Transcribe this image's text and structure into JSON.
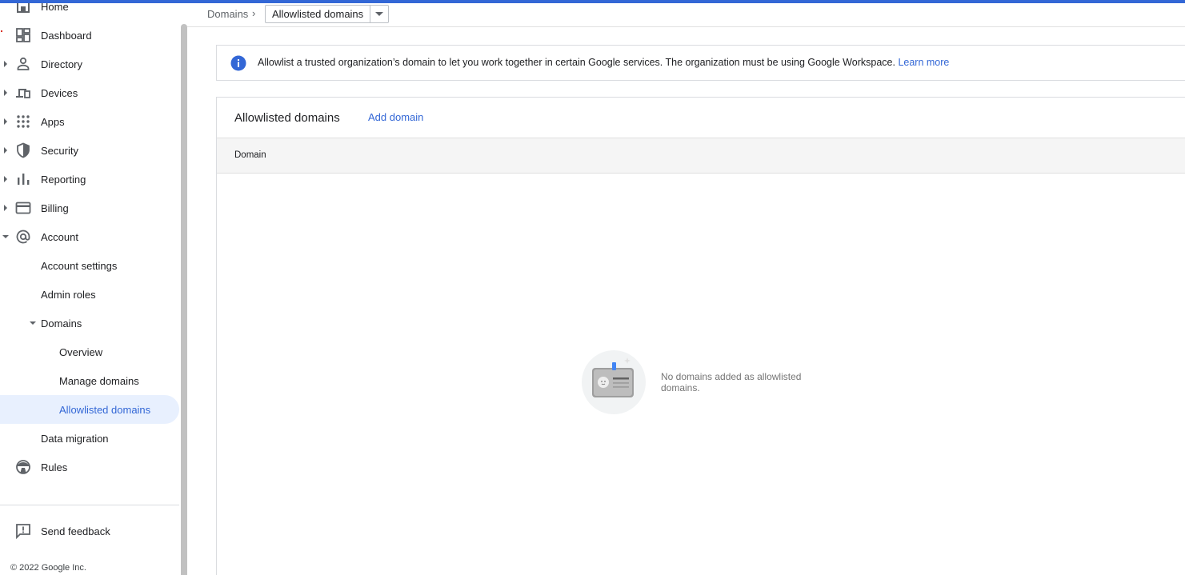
{
  "sidebar": {
    "items": [
      {
        "label": "Home",
        "icon": "home-icon",
        "caret": "none"
      },
      {
        "label": "Dashboard",
        "icon": "dashboard-icon",
        "caret": "none"
      },
      {
        "label": "Directory",
        "icon": "person-icon",
        "caret": "right"
      },
      {
        "label": "Devices",
        "icon": "devices-icon",
        "caret": "right"
      },
      {
        "label": "Apps",
        "icon": "apps-grid-icon",
        "caret": "right"
      },
      {
        "label": "Security",
        "icon": "shield-icon",
        "caret": "right"
      },
      {
        "label": "Reporting",
        "icon": "bar-chart-icon",
        "caret": "right"
      },
      {
        "label": "Billing",
        "icon": "credit-card-icon",
        "caret": "right"
      },
      {
        "label": "Account",
        "icon": "at-sign-icon",
        "caret": "down"
      }
    ],
    "account_children": {
      "account_settings": "Account settings",
      "admin_roles": "Admin roles",
      "domains": "Domains",
      "domains_children": {
        "overview": "Overview",
        "manage_domains": "Manage domains",
        "allowlisted_domains": "Allowlisted domains"
      },
      "data_migration": "Data migration"
    },
    "rules": "Rules",
    "send_feedback": "Send feedback",
    "copyright": "© 2022 Google Inc."
  },
  "breadcrumb": {
    "parent": "Domains",
    "separator": "›",
    "current": "Allowlisted domains"
  },
  "banner": {
    "text": "Allowlist a trusted organization’s domain to let you work together in certain Google services. The organization must be using Google Workspace.",
    "link": "Learn more"
  },
  "card": {
    "title": "Allowlisted domains",
    "action": "Add domain",
    "columns": [
      "Domain"
    ],
    "rows": [],
    "empty_message": "No domains added as allowlisted domains."
  },
  "colors": {
    "accent": "#3367d6",
    "active_bg": "#e8f0fe",
    "info_icon": "#3367d6"
  }
}
